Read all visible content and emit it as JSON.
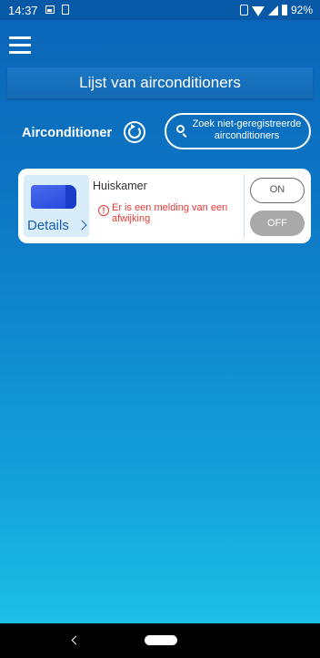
{
  "status_bar": {
    "time": "14:37",
    "battery": "92%"
  },
  "icons": {
    "menu": "hamburger-menu-icon",
    "refresh": "refresh-icon",
    "search": "search-icon",
    "ac_unit": "air-conditioner-icon",
    "warning": "warning-icon",
    "back": "back-icon",
    "home": "home-icon"
  },
  "header": {
    "title": "Lijst van airconditioners"
  },
  "controls": {
    "label": "Airconditioner",
    "search_line1": "Zoek niet-geregistreerde",
    "search_line2": "airconditioners"
  },
  "device": {
    "name": "Huiskamer",
    "details_label": "Details",
    "warning": "Er is een melding van een afwijking",
    "on_label": "ON",
    "off_label": "OFF",
    "state": "off"
  },
  "colors": {
    "accent": "#0d79c6",
    "warning": "#e53935",
    "off_button": "#a9a9a9"
  }
}
